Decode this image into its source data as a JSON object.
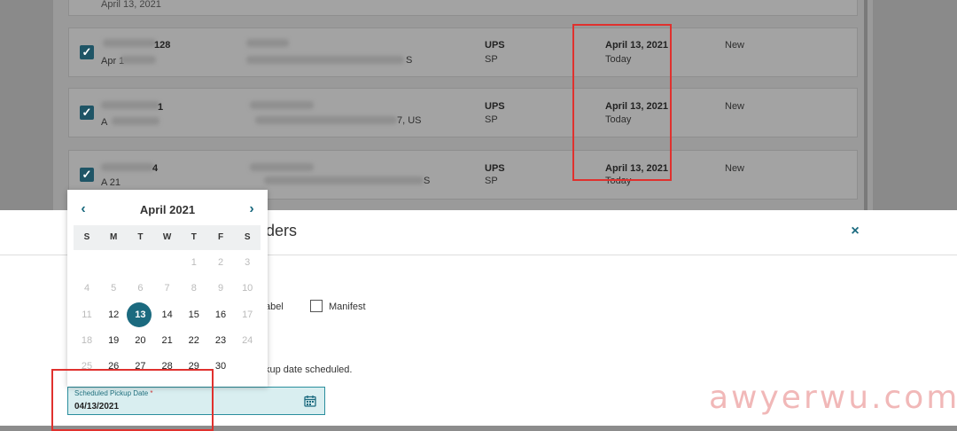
{
  "orders": [
    {
      "order_id": "128",
      "order_date": "Apr 1",
      "address_tail": "S",
      "carrier": "UPS",
      "service": "SP",
      "ship_date": "April 13, 2021",
      "ship_date_note": "Today",
      "status": "New"
    },
    {
      "order_id": "1",
      "order_date": "A",
      "address_tail": "7, US",
      "carrier": "UPS",
      "service": "SP",
      "ship_date": "April 13, 2021",
      "ship_date_note": "Today",
      "status": "New"
    },
    {
      "order_id": "4",
      "order_date": "A 21",
      "address_tail": "S",
      "carrier": "UPS",
      "service": "SP",
      "ship_date": "April 13, 2021",
      "ship_date_note": "Today",
      "status": "New"
    }
  ],
  "top_row_date": "April 13, 2021",
  "modal": {
    "title_fragment": "ders",
    "close_icon": "×",
    "label_fragment": "abel",
    "manifest_label": "Manifest",
    "pickup_fragment": "kup date scheduled."
  },
  "datepicker": {
    "month_title": "April 2021",
    "prev_icon": "‹",
    "next_icon": "›",
    "weekdays": [
      "S",
      "M",
      "T",
      "W",
      "T",
      "F",
      "S"
    ],
    "days": [
      "",
      "",
      "",
      "",
      "1",
      "2",
      "3",
      "4",
      "5",
      "6",
      "7",
      "8",
      "9",
      "10",
      "11",
      "12",
      "13",
      "14",
      "15",
      "16",
      "17",
      "18",
      "19",
      "20",
      "21",
      "22",
      "23",
      "24",
      "25",
      "26",
      "27",
      "28",
      "29",
      "30",
      ""
    ],
    "selected_day": "13"
  },
  "pickup_field": {
    "label": "Scheduled Pickup Date",
    "required_mark": "*",
    "value": "04/13/2021",
    "icon": "calendar-icon"
  },
  "watermark": "awyerwu.com",
  "colors": {
    "accent": "#1b6a7f",
    "highlight_red": "#e0312e",
    "field_bg": "#d9eef0"
  }
}
